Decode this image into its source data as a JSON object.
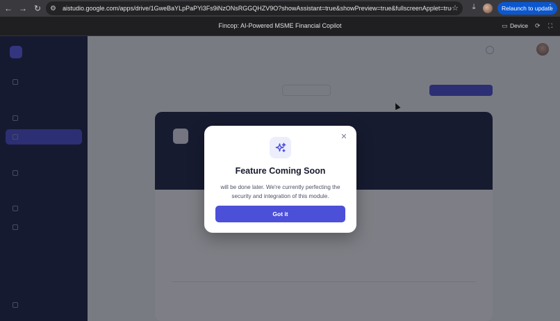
{
  "browser": {
    "url": "aistudio.google.com/apps/drive/1GweBaYLpPaPYi3Fs9iNzONsRGGQHZV9O?showAssistant=true&showPreview=true&fullscreenApplet=true",
    "relaunch_label": "Relaunch to update"
  },
  "studio": {
    "title": "Fincop: AI-Powered MSME Financial Copilot",
    "device_label": "Device"
  },
  "modal": {
    "title": "Feature Coming Soon",
    "message": "will be done later. We're currently perfecting the security and integration of this module.",
    "button_label": "Got it",
    "accent_color": "#4c4fd8"
  },
  "icons": {
    "back": "arrow-left-icon",
    "forward": "arrow-right-icon",
    "reload": "reload-icon",
    "site_settings": "tune-icon",
    "bookmark": "star-icon",
    "download": "download-icon",
    "profile": "profile-avatar",
    "device": "device-icon",
    "refresh": "refresh-icon",
    "fullscreen": "fullscreen-icon",
    "modal": "sparkles-icon",
    "close": "close-icon"
  }
}
